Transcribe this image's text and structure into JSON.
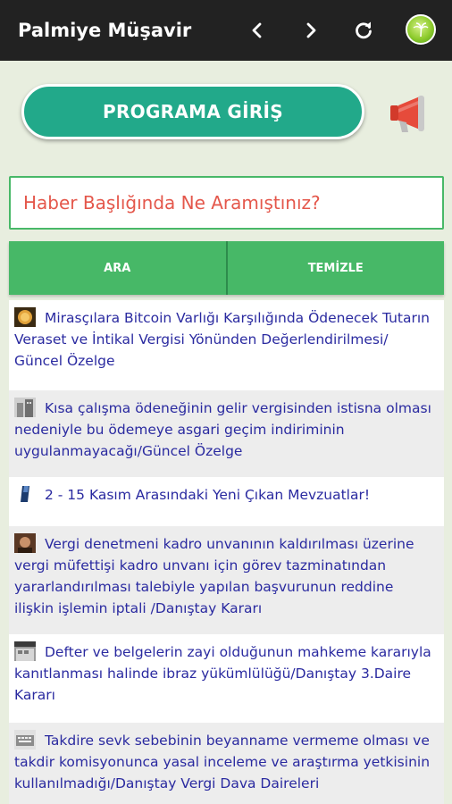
{
  "app": {
    "title": "Palmiye Müşavir",
    "nav_icons": [
      "chevron-left-icon",
      "chevron-right-icon",
      "refresh-icon",
      "palm-avatar-icon"
    ]
  },
  "login": {
    "label": "PROGRAMA GİRİŞ"
  },
  "megaphone": {
    "icon": "megaphone-icon"
  },
  "search": {
    "placeholder": "Haber Başlığında Ne Aramıştınız?",
    "value": ""
  },
  "buttons": {
    "search_label": "ARA",
    "clear_label": "TEMİZLE"
  },
  "colors": {
    "appbar": "#222222",
    "background": "#e8eedf",
    "login_button": "#22a98a",
    "action_buttons": "#47b867",
    "placeholder": "#e4574b",
    "link_text": "#2a2aa0"
  },
  "news": [
    {
      "icon": "bitcoin-thumb-icon",
      "title": "Mirasçılara Bitcoin Varlığı Karşılığında Ödenecek Tutarın Veraset ve İntikal Vergisi Yönünden Değerlendirilmesi/ Güncel Özelge"
    },
    {
      "icon": "building-thumb-icon",
      "title": "Kısa çalışma ödeneğinin gelir vergisinden istisna olması nedeniyle bu ödemeye asgari geçim indiriminin uygulanmayacağı/Güncel Özelge"
    },
    {
      "icon": "document-thumb-icon",
      "title": "2 - 15 Kasım Arasındaki Yeni Çıkan Mevzuatlar!"
    },
    {
      "icon": "court-thumb-icon",
      "title": "Vergi denetmeni kadro unvanının kaldırılması üzerine vergi müfettişi kadro unvanı için görev tazminatından yararlandırılması talebiyle yapılan başvurunun reddine ilişkin işlemin iptali /Danıştay Kararı"
    },
    {
      "icon": "building-thumb-icon",
      "title": "Defter ve belgelerin zayi olduğunun mahkeme kararıyla kanıtlanması halinde ibraz yükümlülüğü/Danıştay 3.Daire Kararı"
    },
    {
      "icon": "keyboard-thumb-icon",
      "title": "Takdire sevk sebebinin beyanname vermeme olması ve takdir komisyonunca yasal inceleme ve araştırma yetkisinin kullanılmadığı/Danıştay Vergi Dava Daireleri"
    }
  ]
}
